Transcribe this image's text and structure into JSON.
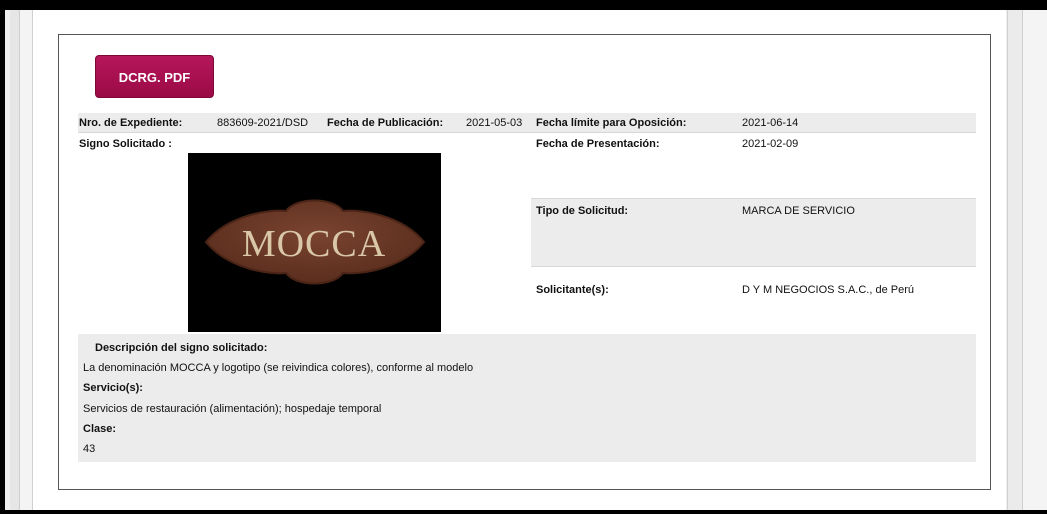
{
  "download_button": {
    "label": "DCRG. PDF"
  },
  "expediente": {
    "nro_label": "Nro. de Expediente:",
    "nro_value": "883609-2021/DSD",
    "publicacion_label": "Fecha de Publicación:",
    "publicacion_value": "2021-05-03",
    "limite_label": "Fecha límite para Oposición:",
    "limite_value": "2021-06-14"
  },
  "signo": {
    "label": "Signo Solicitado :",
    "logo_text": "MOCCA"
  },
  "details": {
    "presentacion_label": "Fecha de Presentación:",
    "presentacion_value": "2021-02-09",
    "tipo_label": "Tipo de Solicitud:",
    "tipo_value": "MARCA DE SERVICIO",
    "solicitante_label": "Solicitante(s):",
    "solicitante_value": "D Y M NEGOCIOS S.A.C., de Perú"
  },
  "descripcion": {
    "title": "Descripción del signo solicitado:",
    "text": "La denominación MOCCA y logotipo (se reivindica colores), conforme al modelo",
    "servicios_title": "Servicio(s):",
    "servicios_text": "Servicios de restauración (alimentación); hospedaje temporal",
    "clase_title": "Clase:",
    "clase_value": "43"
  },
  "colors": {
    "button": "#a60f4f",
    "logo_brown": "#6b3a26",
    "logo_cream": "#d9c7a8",
    "row_shade": "#ececec"
  }
}
